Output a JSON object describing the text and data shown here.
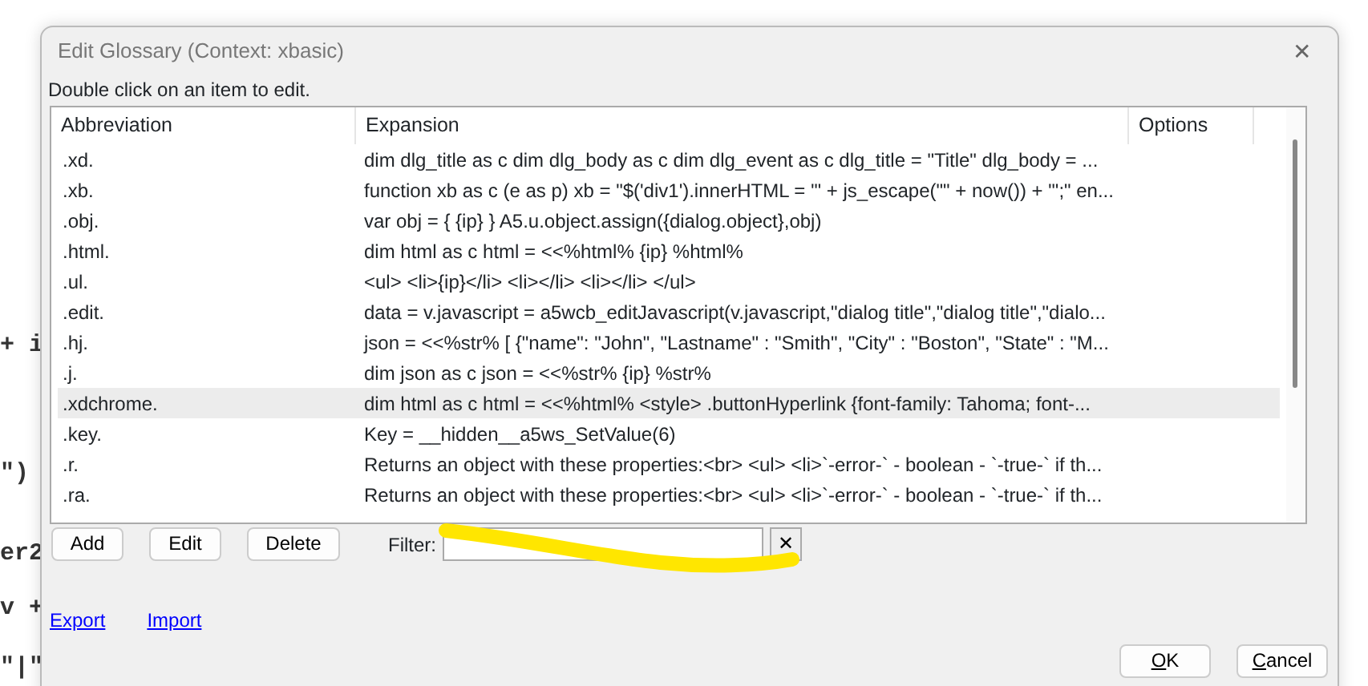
{
  "editor_fragments": [
    {
      "text": "+ i"
    },
    {
      "text": "\")"
    },
    {
      "text": "er2"
    },
    {
      "text": "v +"
    },
    {
      "text": "\"|\""
    }
  ],
  "window": {
    "title": "Edit Glossary (Context: xbasic)",
    "close": "✕"
  },
  "hint": "Double click on an item to edit.",
  "table": {
    "columns": [
      "Abbreviation",
      "Expansion",
      "Options"
    ],
    "rows": [
      {
        "abbreviation": ".xd.",
        "expansion": "dim dlg_title as c  dim dlg_body as c  dim dlg_event as c  dlg_title = \"Title\" dlg_body = ...",
        "selected": false
      },
      {
        "abbreviation": ".xb.",
        "expansion": "function xb as c (e as p) xb = \"$('div1').innerHTML = '\" + js_escape(\"\" + now()) + \"';\" en...",
        "selected": false
      },
      {
        "abbreviation": ".obj.",
        "expansion": "var obj = {  {ip} } A5.u.object.assign({dialog.object},obj)",
        "selected": false
      },
      {
        "abbreviation": ".html.",
        "expansion": "dim html as c  html = <<%html% {ip} %html%",
        "selected": false
      },
      {
        "abbreviation": ".ul.",
        "expansion": "<ul> <li>{ip}</li> <li></li> <li></li> </ul>",
        "selected": false
      },
      {
        "abbreviation": ".edit.",
        "expansion": "data = v.javascript = a5wcb_editJavascript(v.javascript,\"dialog title\",\"dialog title\",\"dialo...",
        "selected": false
      },
      {
        "abbreviation": ".hj.",
        "expansion": "json = <<%str% [ {\"name\": \"John\", \"Lastname\" : \"Smith\", \"City\" : \"Boston\", \"State\" : \"M...",
        "selected": false
      },
      {
        "abbreviation": ".j.",
        "expansion": "dim json as c  json = <<%str% {ip} %str%",
        "selected": false
      },
      {
        "abbreviation": ".xdchrome.",
        "expansion": "dim html as c html = <<%html% <style> .buttonHyperlink {font-family: Tahoma; font-...",
        "selected": true
      },
      {
        "abbreviation": ".key.",
        "expansion": "Key = __hidden__a5ws_SetValue(6)",
        "selected": false
      },
      {
        "abbreviation": ".r.",
        "expansion": "Returns an object with these properties:<br> <ul> <li>`-error-` - boolean - `-true-` if th...",
        "selected": false
      },
      {
        "abbreviation": ".ra.",
        "expansion": "Returns an object with these properties:<br> <ul> <li>`-error-` - boolean - `-true-` if th...",
        "selected": false
      }
    ]
  },
  "buttons": [
    "Add",
    "Edit",
    "Delete"
  ],
  "filter": {
    "label": "Filter:",
    "clear": "✕"
  },
  "annotation": {
    "kind": "highlight"
  },
  "links": [
    "Export",
    "Import"
  ],
  "dialog_buttons": [
    {
      "label": "OK"
    },
    {
      "label": "Cancel"
    }
  ]
}
